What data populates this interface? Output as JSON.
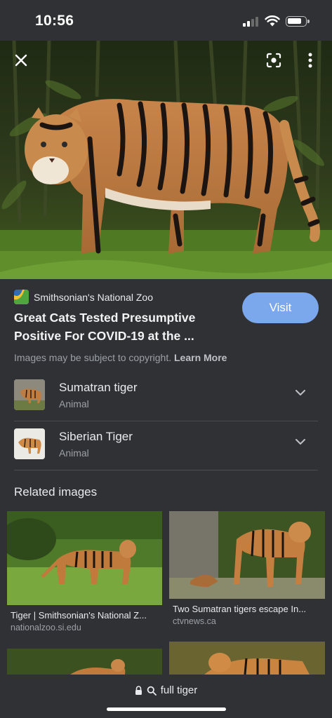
{
  "status_bar": {
    "time": "10:56"
  },
  "hero": {
    "alt": "Sumatran tiger standing on grass"
  },
  "result": {
    "source_name": "Smithsonian's National Zoo",
    "title": "Great Cats Tested Presumptive Positive For COVID-19 at the ...",
    "visit_label": "Visit",
    "copyright_text": "Images may be subject to copyright.",
    "learn_more": "Learn More"
  },
  "entities": [
    {
      "name": "Sumatran tiger",
      "kind": "Animal"
    },
    {
      "name": "Siberian Tiger",
      "kind": "Animal"
    }
  ],
  "related": {
    "heading": "Related images",
    "items": [
      {
        "caption": "Tiger | Smithsonian's National Z...",
        "domain": "nationalzoo.si.edu"
      },
      {
        "caption": "Two Sumatran tigers escape In...",
        "domain": "ctvnews.ca"
      }
    ]
  },
  "address_bar": {
    "query": "full tiger"
  },
  "colors": {
    "background": "#303134",
    "accent": "#7ba7ec",
    "secondary_text": "#9aa0a6"
  }
}
